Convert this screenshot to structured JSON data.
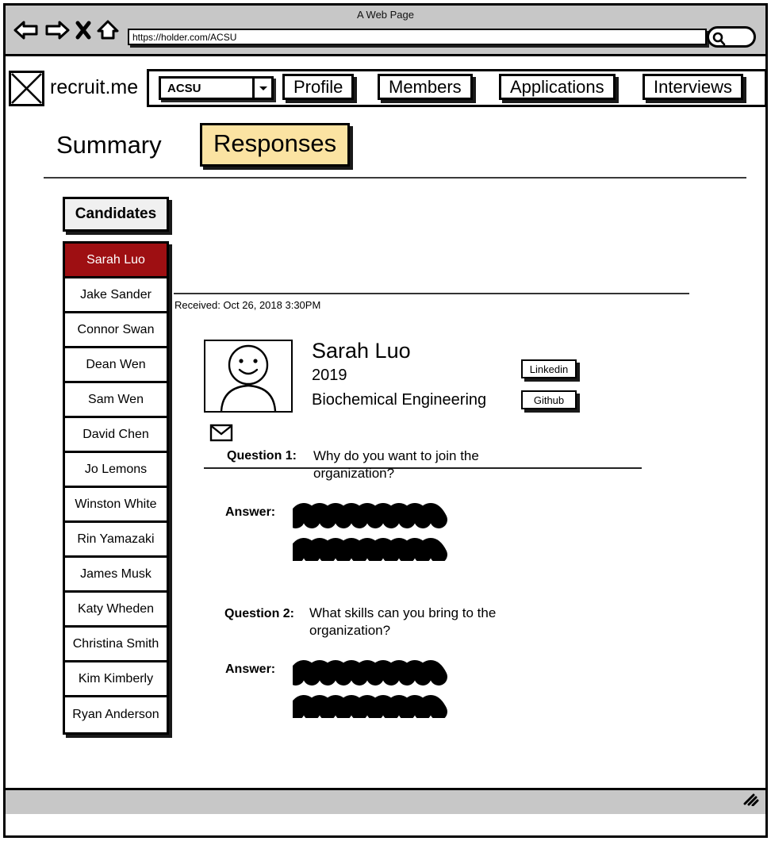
{
  "browser": {
    "window_title": "A Web Page",
    "url": "https://holder.com/ACSU",
    "search_placeholder": "",
    "icons": {
      "back": "back-arrow-icon",
      "forward": "forward-arrow-icon",
      "stop": "close-x-icon",
      "home": "home-icon",
      "search": "search-icon",
      "resize": "resize-grip-icon"
    }
  },
  "header": {
    "logo": "placeholder-image-icon",
    "brand": "recruit.me",
    "org_select": {
      "value": "ACSU",
      "options": [
        "ACSU"
      ]
    },
    "nav": [
      {
        "label": "Profile"
      },
      {
        "label": "Members"
      },
      {
        "label": "Applications"
      },
      {
        "label": "Interviews"
      }
    ]
  },
  "tabs": [
    {
      "label": "Summary",
      "active": false
    },
    {
      "label": "Responses",
      "active": true
    }
  ],
  "panel": {
    "candidates_tab_label": "Candidates",
    "candidates": [
      {
        "name": "Sarah Luo",
        "selected": true
      },
      {
        "name": "Jake Sander",
        "selected": false
      },
      {
        "name": "Connor Swan",
        "selected": false
      },
      {
        "name": "Dean Wen",
        "selected": false
      },
      {
        "name": "Sam Wen",
        "selected": false
      },
      {
        "name": "David Chen",
        "selected": false
      },
      {
        "name": "Jo Lemons",
        "selected": false
      },
      {
        "name": "Winston White",
        "selected": false
      },
      {
        "name": "Rin Yamazaki",
        "selected": false
      },
      {
        "name": "James Musk",
        "selected": false
      },
      {
        "name": "Katy Wheden",
        "selected": false
      },
      {
        "name": "Christina Smith",
        "selected": false
      },
      {
        "name": "Kim Kimberly",
        "selected": false
      },
      {
        "name": "Ryan Anderson",
        "selected": false
      }
    ]
  },
  "detail": {
    "received": "Received: Oct 26, 2018 3:30PM",
    "avatar": "user-avatar-icon",
    "name": "Sarah Luo",
    "year": "2019",
    "major": "Biochemical Engineering",
    "mail_icon": "envelope-icon",
    "links": [
      {
        "label": "Linkedin"
      },
      {
        "label": "Github"
      }
    ],
    "qa": [
      {
        "q_label": "Question 1:",
        "q_text": "Why do you want to join the organization?",
        "a_label": "Answer:",
        "a_text": ""
      },
      {
        "q_label": "Question 2:",
        "q_text": "What skills can you bring to the organization?",
        "a_label": "Answer:",
        "a_text": ""
      }
    ]
  },
  "colors": {
    "accent_selected": "#9e0f12",
    "tab_active_bg": "#fbe3a2",
    "chrome_bg": "#c7c7c7",
    "button_bg": "#f0f0f0"
  }
}
